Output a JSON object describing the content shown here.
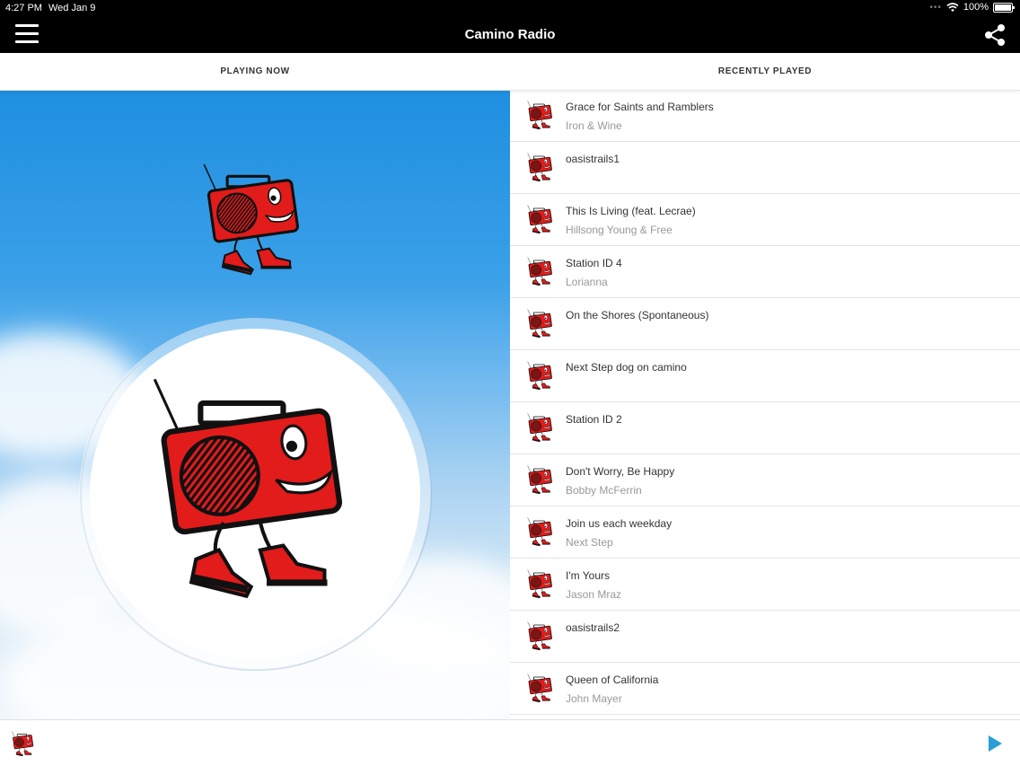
{
  "status_bar": {
    "time": "4:27 PM",
    "date": "Wed Jan 9",
    "battery": "100%"
  },
  "header": {
    "title": "Camino Radio",
    "menu_icon": "hamburger-menu-icon",
    "share_icon": "share-icon"
  },
  "tabs": [
    {
      "label": "PLAYING NOW"
    },
    {
      "label": "RECENTLY PLAYED"
    }
  ],
  "recently_played": [
    {
      "title": "Grace for Saints and Ramblers",
      "artist": "Iron & Wine"
    },
    {
      "title": "oasistrails1",
      "artist": ""
    },
    {
      "title": "This Is Living (feat. Lecrae)",
      "artist": "Hillsong Young & Free"
    },
    {
      "title": "Station ID 4",
      "artist": "Lorianna"
    },
    {
      "title": "On the Shores (Spontaneous)",
      "artist": ""
    },
    {
      "title": "Next Step dog on camino",
      "artist": ""
    },
    {
      "title": "Station ID 2",
      "artist": ""
    },
    {
      "title": "Don't Worry, Be Happy",
      "artist": "Bobby McFerrin"
    },
    {
      "title": "Join us each weekday",
      "artist": "Next Step"
    },
    {
      "title": "I'm Yours",
      "artist": "Jason Mraz"
    },
    {
      "title": "oasistrails2",
      "artist": ""
    },
    {
      "title": "Queen of California",
      "artist": "John Mayer"
    }
  ],
  "player": {
    "play_icon": "play-icon"
  },
  "colors": {
    "accent_play": "#2a9fd6",
    "logo_red": "#e21b1b",
    "bar": "#000000"
  }
}
